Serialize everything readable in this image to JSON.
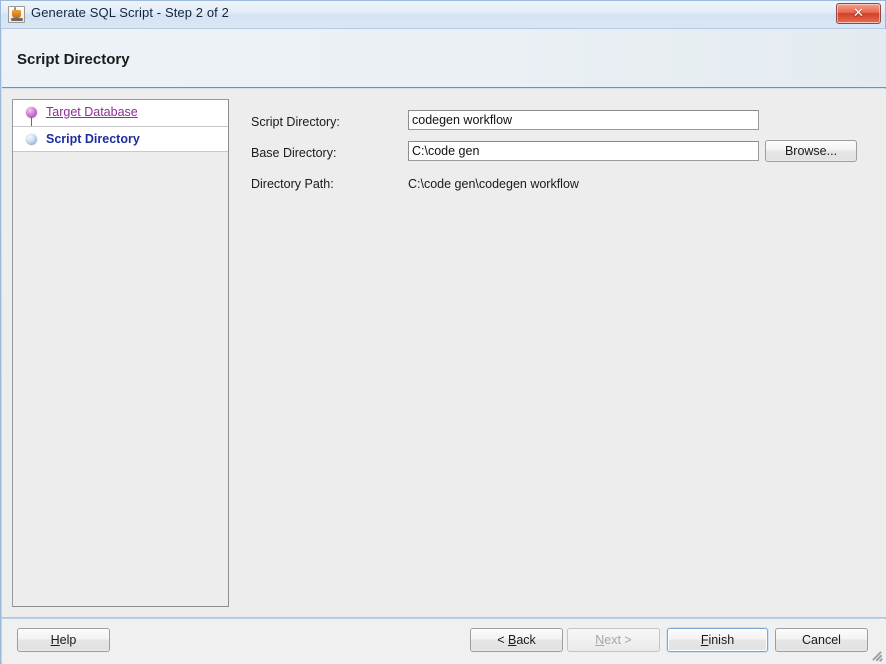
{
  "window": {
    "title": "Generate SQL Script - Step 2 of 2",
    "icon": "java-application-icon",
    "close_label": "✕"
  },
  "banner": {
    "title": "Script Directory"
  },
  "steps": {
    "items": [
      {
        "label": "Target Database",
        "state": "visited",
        "icon": "purple-sphere-icon"
      },
      {
        "label": "Script Directory",
        "state": "current",
        "icon": "blue-sphere-icon"
      }
    ]
  },
  "form": {
    "fields": [
      {
        "label": "Script Directory:",
        "value": "codegen workflow",
        "placeholder": "",
        "type": "text"
      },
      {
        "label": "Base Directory:",
        "value": "C:\\code gen",
        "placeholder": "",
        "type": "text"
      },
      {
        "label": "Directory Path:",
        "value": "C:\\code gen\\codegen workflow",
        "type": "static"
      }
    ],
    "browse_label": "Browse..."
  },
  "footer": {
    "help": {
      "pre": "H",
      "mnemonic": "",
      "label": "Help"
    },
    "help_label_before": "",
    "help_mnemonic": "H",
    "help_label_after": "elp",
    "back_before": "< ",
    "back_mnemonic": "B",
    "back_after": "ack",
    "next_before": "",
    "next_mnemonic": "N",
    "next_after": "ext >",
    "finish_before": "",
    "finish_mnemonic": "F",
    "finish_after": "inish",
    "cancel_label": "Cancel"
  },
  "colors": {
    "titlebar_text": "#12263d",
    "close_button": "#d0402a",
    "link_purple": "#8b2f94",
    "current_blue": "#1b2fa0",
    "focus_ring": "#7ba7d0"
  }
}
